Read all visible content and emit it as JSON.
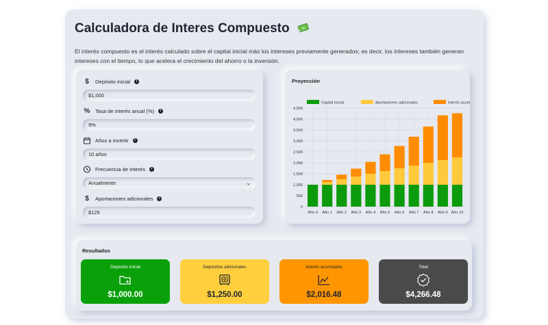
{
  "header": {
    "title": "Calculadora de Interes Compuesto",
    "icon": "money-with-wings-icon",
    "intro": "El interés compuesto es el interés calculado sobre el capital inicial más los intereses previamente generados; es decir, los intereses también generan intereses con el tiempo, lo que acelera el crecimiento del ahorro o la inversión."
  },
  "form": {
    "fields": [
      {
        "icon": "dollar-icon",
        "label": "Depósito inicial",
        "value": "$1,000"
      },
      {
        "icon": "percent-icon",
        "label": "Tasa de interés anual (%)",
        "value": "9%"
      },
      {
        "icon": "calendar-icon",
        "label": "Años a invertir",
        "value": "10 años"
      },
      {
        "icon": "clock-icon",
        "label": "Frecuencia de interés",
        "value": "Anualmente"
      },
      {
        "icon": "dollar-icon",
        "label": "Aportaciones adicionales",
        "value": "$125"
      }
    ]
  },
  "chart": {
    "title": "Proyección"
  },
  "chart_data": {
    "type": "bar",
    "stacked": true,
    "categories": [
      "Año 0",
      "Año 1",
      "Año 2",
      "Año 3",
      "Año 4",
      "Año 5",
      "Año 6",
      "Año 7",
      "Año 8",
      "Año 9",
      "Año 10"
    ],
    "series": [
      {
        "name": "Capital inicial",
        "color": "#0c9b0c",
        "values": [
          1000,
          1000,
          1000,
          1000,
          1000,
          1000,
          1000,
          1000,
          1000,
          1000,
          1000
        ]
      },
      {
        "name": "Aportaciones adicionales",
        "color": "#ffc93c",
        "values": [
          0,
          125,
          250,
          375,
          500,
          625,
          750,
          875,
          1000,
          1125,
          1250
        ]
      },
      {
        "name": "Interés acumulado",
        "color": "#ff8c00",
        "values": [
          0,
          90,
          209,
          360,
          544,
          764,
          1021,
          1318,
          1659,
          2046,
          2016
        ]
      }
    ],
    "ylim": [
      0,
      4500
    ],
    "yticks": [
      "0",
      "500",
      "1,000",
      "1,500",
      "2,000",
      "2,500",
      "3,000",
      "3,500",
      "4,000",
      "4,500"
    ],
    "grid": true,
    "legend": "top"
  },
  "results": {
    "title": "Resultados",
    "cards": [
      {
        "label": "Depósito inicial",
        "value": "$1,000.00",
        "icon": "folder-sparkle-icon",
        "bg": "#0aa00a",
        "fg": "#ffffff"
      },
      {
        "label": "Depósitos adicionales",
        "value": "$1,250.00",
        "icon": "safe-icon",
        "bg": "#ffcf3d",
        "fg": "#1e2430"
      },
      {
        "label": "Interés acumulado",
        "value": "$2,016.48",
        "icon": "trending-up-icon",
        "bg": "#ff9500",
        "fg": "#1e2430"
      },
      {
        "label": "Total",
        "value": "$4,266.48",
        "icon": "badge-check-icon",
        "bg": "#4a4a4a",
        "fg": "#ffffff"
      }
    ]
  }
}
